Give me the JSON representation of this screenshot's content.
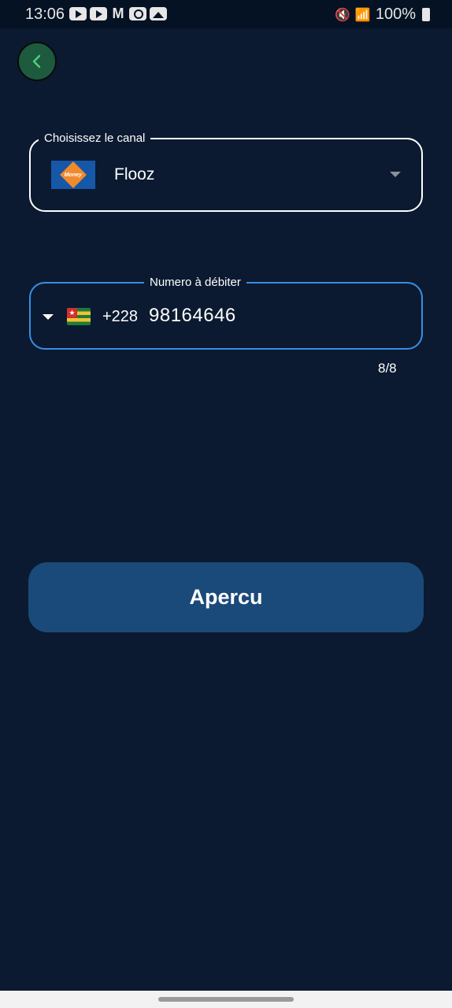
{
  "status_bar": {
    "time": "13:06",
    "battery": "100%",
    "left_icons": [
      "youtube-icon",
      "youtube-icon",
      "gmail-icon",
      "camera-icon",
      "gallery-icon"
    ],
    "right_icons": [
      "mute-icon",
      "wifi-icon",
      "signal-icon",
      "battery-icon"
    ]
  },
  "header": {
    "back_icon": "chevron-left-icon"
  },
  "channel": {
    "label": "Choisissez le canal",
    "value": "Flooz",
    "logo": "flooz-moov-money-logo",
    "logo_text": "Money"
  },
  "phone": {
    "label": "Numero à débiter",
    "country_flag": "togo-flag",
    "dial_code": "+228",
    "number": "98164646",
    "counter": "8/8"
  },
  "actions": {
    "preview_label": "Apercu"
  },
  "colors": {
    "background": "#0b1a30",
    "accent_blue": "#3a8ee6",
    "button": "#1a4a79",
    "back_button": "#1d5a3e",
    "back_chevron": "#4cd07d"
  }
}
